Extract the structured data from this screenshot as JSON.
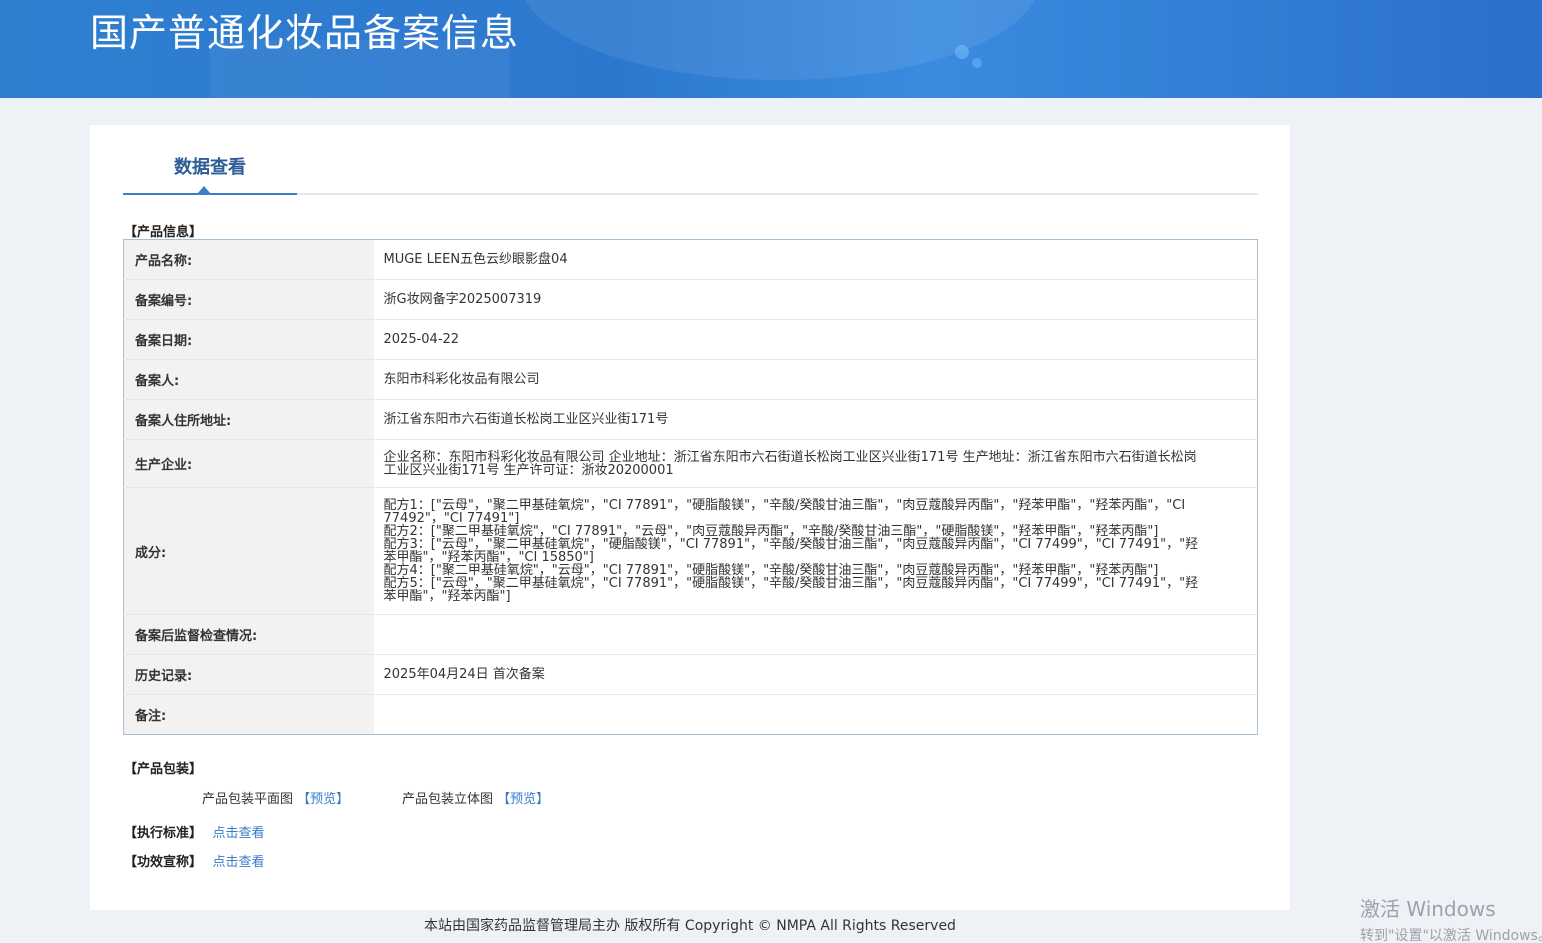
{
  "banner": {
    "title": "国产普通化妆品备案信息"
  },
  "tab": {
    "label": "数据查看"
  },
  "product_info": {
    "section_title": "【产品信息】",
    "rows": [
      {
        "key": "产品名称:",
        "value": "MUGE LEEN五色云纱眼影盘04"
      },
      {
        "key": "备案编号:",
        "value": "浙G妆网备字2025007319"
      },
      {
        "key": "备案日期:",
        "value": "2025-04-22"
      },
      {
        "key": "备案人:",
        "value": "东阳市科彩化妆品有限公司"
      },
      {
        "key": "备案人住所地址:",
        "value": "浙江省东阳市六石街道长松岗工业区兴业街171号"
      },
      {
        "key": "生产企业:",
        "value": "企业名称：东阳市科彩化妆品有限公司 企业地址：浙江省东阳市六石街道长松岗工业区兴业街171号 生产地址：浙江省东阳市六石街道长松岗工业区兴业街171号 生产许可证：浙妆20200001"
      },
      {
        "key": "成分:",
        "lines": [
          "配方1：[\"云母\"，\"聚二甲基硅氧烷\"，\"CI 77891\"，\"硬脂酸镁\"，\"辛酸/癸酸甘油三酯\"，\"肉豆蔻酸异丙酯\"，\"羟苯甲酯\"，\"羟苯丙酯\"，\"CI 77492\"，\"CI 77491\"]",
          "配方2：[\"聚二甲基硅氧烷\"，\"CI 77891\"，\"云母\"，\"肉豆蔻酸异丙酯\"，\"辛酸/癸酸甘油三酯\"，\"硬脂酸镁\"，\"羟苯甲酯\"，\"羟苯丙酯\"]",
          "配方3：[\"云母\"，\"聚二甲基硅氧烷\"，\"硬脂酸镁\"，\"CI 77891\"，\"辛酸/癸酸甘油三酯\"，\"肉豆蔻酸异丙酯\"，\"CI 77499\"，\"CI 77491\"，\"羟苯甲酯\"，\"羟苯丙酯\"，\"CI 15850\"]",
          "配方4：[\"聚二甲基硅氧烷\"，\"云母\"，\"CI 77891\"，\"硬脂酸镁\"，\"辛酸/癸酸甘油三酯\"，\"肉豆蔻酸异丙酯\"，\"羟苯甲酯\"，\"羟苯丙酯\"]",
          "配方5：[\"云母\"，\"聚二甲基硅氧烷\"，\"CI 77891\"，\"硬脂酸镁\"，\"辛酸/癸酸甘油三酯\"，\"肉豆蔻酸异丙酯\"，\"CI 77499\"，\"CI 77491\"，\"羟苯甲酯\"，\"羟苯丙酯\"]"
        ]
      },
      {
        "key": "备案后监督检查情况:",
        "value": ""
      },
      {
        "key": "历史记录:",
        "value": "2025年04月24日 首次备案"
      },
      {
        "key": "备注:",
        "value": ""
      }
    ]
  },
  "packaging": {
    "section_title": "【产品包装】",
    "flat_label": "产品包装平面图",
    "flat_link": "【预览】",
    "solid_label": "产品包装立体图",
    "solid_link": "【预览】"
  },
  "standard": {
    "label": "【执行标准】",
    "link": "点击查看"
  },
  "efficacy": {
    "label": "【功效宣称】",
    "link": "点击查看"
  },
  "footer": {
    "text": "本站由国家药品监督管理局主办 版权所有 Copyright © NMPA All Rights Reserved"
  },
  "watermark": {
    "line1": "激活 Windows",
    "line2": "转到\"设置\"以激活 Windows。"
  }
}
